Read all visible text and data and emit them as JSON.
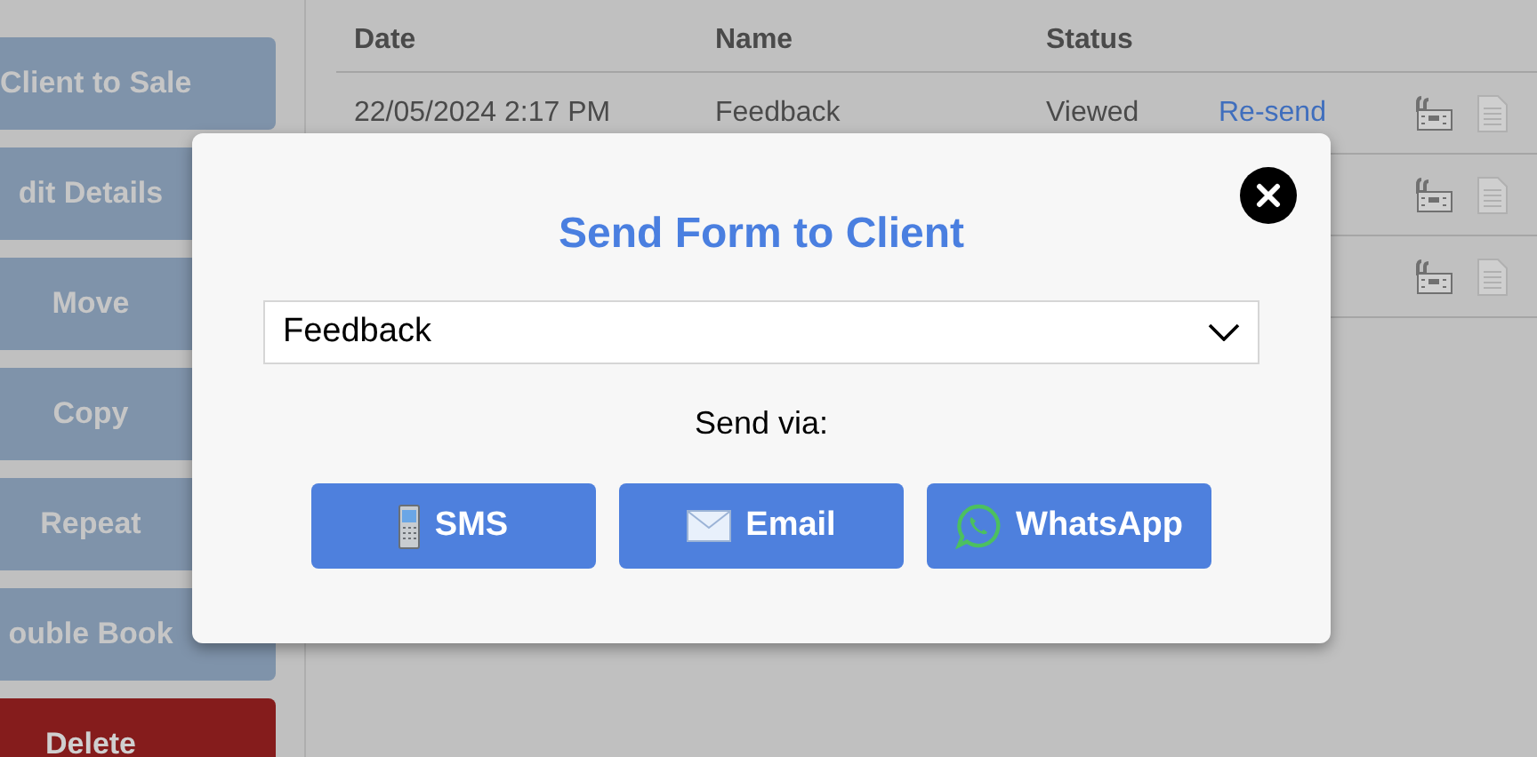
{
  "sidebar": {
    "buttons": [
      {
        "label": "Client to Sale",
        "kind": "normal"
      },
      {
        "label": "dit Details",
        "kind": "normal"
      },
      {
        "label": "Move",
        "kind": "normal"
      },
      {
        "label": "Copy",
        "kind": "normal"
      },
      {
        "label": "Repeat",
        "kind": "normal"
      },
      {
        "label": "ouble Book",
        "kind": "normal"
      },
      {
        "label": "Delete",
        "kind": "danger"
      }
    ]
  },
  "table": {
    "columns": [
      "Date",
      "Name",
      "Status"
    ],
    "rows": [
      {
        "date": "22/05/2024 2:17 PM",
        "name": "Feedback",
        "status": "Viewed",
        "action": "Re-send"
      },
      {},
      {}
    ]
  },
  "dialog": {
    "title": "Send Form to Client",
    "form_select": {
      "value": "Feedback"
    },
    "send_via_label": "Send via:",
    "buttons": [
      {
        "label": "SMS",
        "kind": "sms"
      },
      {
        "label": "Email",
        "kind": "email"
      },
      {
        "label": "WhatsApp",
        "kind": "whatsapp"
      }
    ]
  }
}
